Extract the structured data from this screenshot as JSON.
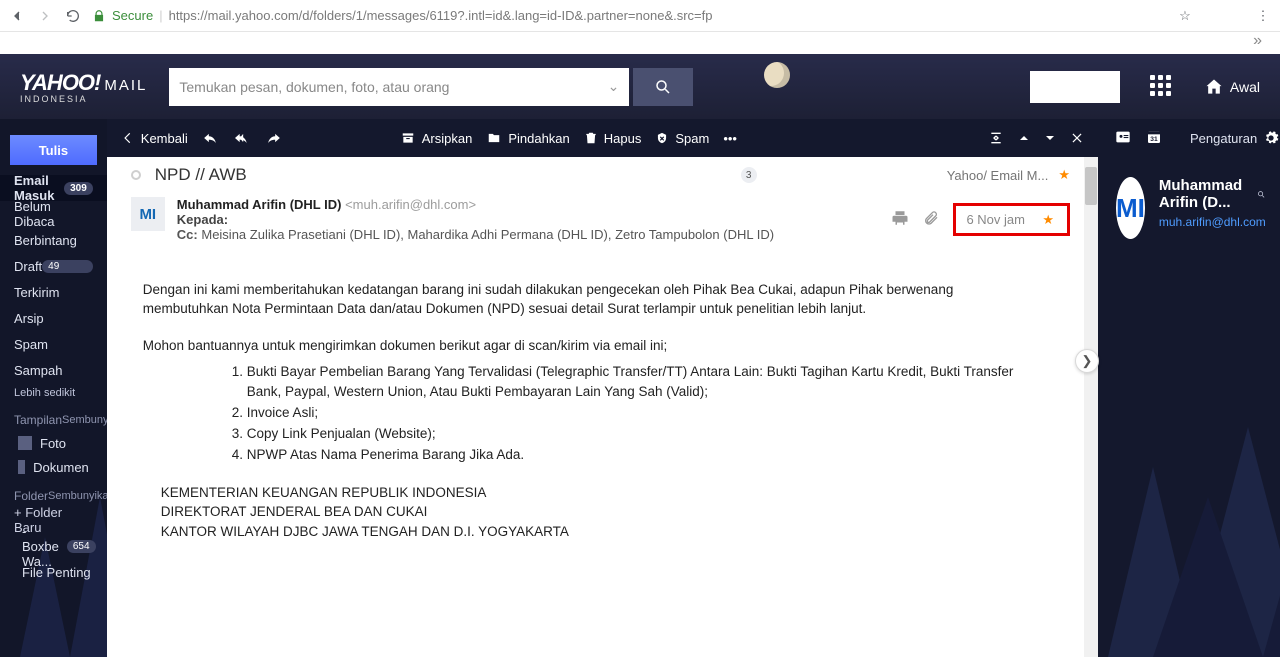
{
  "chrome": {
    "secure": "Secure",
    "url": "https://mail.yahoo.com/d/folders/1/messages/6119?.intl=id&.lang=id-ID&.partner=none&.src=fp"
  },
  "header": {
    "brand": "YAHOO!",
    "brand_mail": "MAIL",
    "brand_sub": "INDONESIA",
    "search_placeholder": "Temukan pesan, dokumen, foto, atau orang",
    "home": "Awal"
  },
  "sidebar": {
    "compose": "Tulis",
    "folders": [
      {
        "label": "Email Masuk",
        "badge": "309",
        "active": true
      },
      {
        "label": "Belum Dibaca"
      },
      {
        "label": "Berbintang"
      },
      {
        "label": "Draft",
        "badge": "49",
        "right": true
      },
      {
        "label": "Terkirim"
      },
      {
        "label": "Arsip"
      },
      {
        "label": "Spam"
      },
      {
        "label": "Sampah"
      }
    ],
    "less": "Lebih sedikit",
    "view_head": "Tampilan",
    "hide": "Sembunyikan",
    "views": [
      {
        "label": "Foto"
      },
      {
        "label": "Dokumen"
      }
    ],
    "folder_head": "Folder",
    "folder_new": "+ Folder Baru",
    "user_folders": [
      {
        "label": "-Boxbe Wa...",
        "badge": "654"
      },
      {
        "label": "File Penting"
      }
    ]
  },
  "toolbar": {
    "back": "Kembali",
    "archive": "Arsipkan",
    "move": "Pindahkan",
    "delete": "Hapus",
    "spam": "Spam"
  },
  "message": {
    "subject": "NPD // AWB",
    "count": "3",
    "folder_path": "Yahoo/ Email M...",
    "from_name": "Muhammad Arifin (DHL ID)",
    "from_email": "<muh.arifin@dhl.com>",
    "to_label": "Kepada:",
    "cc_label": "Cc:",
    "cc_value": "Meisina Zulika Prasetiani (DHL ID),  Mahardika Adhi Permana (DHL ID), Zetro Tampubolon (DHL ID)",
    "date": "6 Nov jam",
    "avatar": "MI",
    "body_p1": "Dengan ini kami memberitahukan kedatangan barang ini sudah dilakukan pengecekan oleh Pihak Bea Cukai, adapun Pihak berwenang membutuhkan Nota Permintaan Data dan/atau Dokumen (NPD) sesuai detail Surat terlampir untuk penelitian lebih lanjut.",
    "body_p2": "Mohon bantuannya untuk mengirimkan dokumen berikut agar di scan/kirim via email ini;",
    "list": [
      "Bukti Bayar Pembelian Barang Yang Tervalidasi (Telegraphic Transfer/TT) Antara Lain: Bukti Tagihan Kartu Kredit, Bukti Transfer Bank, Paypal, Western Union, Atau Bukti Pembayaran Lain Yang Sah (Valid);",
      "Invoice Asli;",
      "Copy Link Penjualan (Website);",
      "NPWP Atas Nama Penerima Barang Jika Ada."
    ],
    "foot1": "KEMENTERIAN KEUANGAN REPUBLIK INDONESIA",
    "foot2": "DIREKTORAT JENDERAL BEA DAN CUKAI",
    "foot3": "KANTOR WILAYAH DJBC JAWA TENGAH DAN D.I. YOGYAKARTA"
  },
  "right": {
    "settings": "Pengaturan",
    "contact_name": "Muhammad Arifin (D...",
    "contact_email": "muh.arifin@dhl.com",
    "avatar": "MI"
  }
}
